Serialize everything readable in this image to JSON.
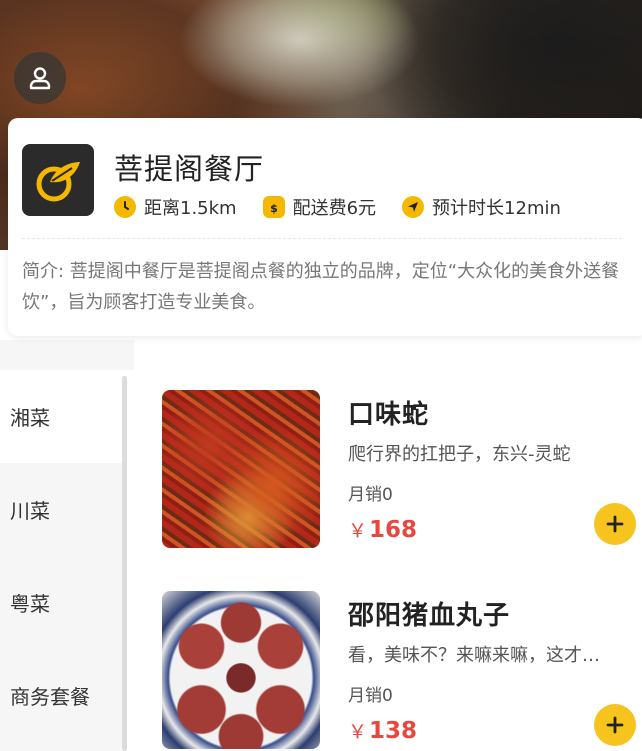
{
  "shop": {
    "name": "菩提阁餐厅",
    "distance": "距离1.5km",
    "delivery_fee": "配送费6元",
    "eta": "预计时长12min",
    "description": "简介: 菩提阁中餐厅是菩提阁点餐的独立的品牌，定位“大众化的美食外送餐饮”，旨为顾客打造专业美食。"
  },
  "categories": [
    {
      "label": "湘菜",
      "active": true
    },
    {
      "label": "川菜",
      "active": false
    },
    {
      "label": "粤菜",
      "active": false
    },
    {
      "label": "商务套餐",
      "active": false
    }
  ],
  "products": [
    {
      "title": "口味蛇",
      "desc": "爬行界的扛把子，东兴-灵蛇",
      "sales": "月销0",
      "currency": "￥",
      "price": "168"
    },
    {
      "title": "邵阳猪血丸子",
      "desc": "看，美味不？来嘛来嘛，这才是最",
      "sales": "月销0",
      "currency": "￥",
      "price": "138"
    }
  ],
  "icons": {
    "user": "user-icon",
    "distance": "clock-icon",
    "fee": "money-bag-icon",
    "eta": "navigation-icon",
    "add": "plus-icon"
  },
  "colors": {
    "accent": "#f6c31f",
    "price": "#e8473d",
    "meta_icon": "#f5b800"
  }
}
